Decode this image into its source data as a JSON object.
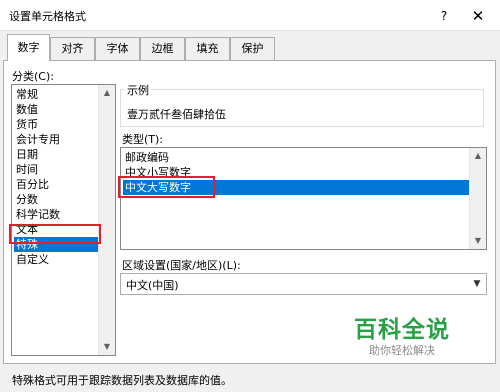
{
  "window": {
    "title": "设置单元格格式",
    "help_label": "?",
    "close_label": "✕"
  },
  "tabs": [
    {
      "label": "数字",
      "active": true
    },
    {
      "label": "对齐",
      "active": false
    },
    {
      "label": "字体",
      "active": false
    },
    {
      "label": "边框",
      "active": false
    },
    {
      "label": "填充",
      "active": false
    },
    {
      "label": "保护",
      "active": false
    }
  ],
  "category": {
    "label": "分类(C):",
    "items": [
      "常规",
      "数值",
      "货币",
      "会计专用",
      "日期",
      "时间",
      "百分比",
      "分数",
      "科学记数",
      "文本",
      "特殊",
      "自定义"
    ],
    "selected": "特殊"
  },
  "sample": {
    "label": "示例",
    "value": "壹万贰仟叁佰肆拾伍"
  },
  "type": {
    "label": "类型(T):",
    "items": [
      "邮政编码",
      "中文小写数字",
      "中文大写数字"
    ],
    "selected": "中文大写数字"
  },
  "locale": {
    "label": "区域设置(国家/地区)(L):",
    "value": "中文(中国)"
  },
  "description": "特殊格式可用于跟踪数据列表及数据库的值。",
  "watermark": {
    "main": "百科全说",
    "sub": "助你轻松解决"
  },
  "colors": {
    "selection": "#0078d7",
    "highlight_box": "#e0202b",
    "watermark": "#2aa046"
  },
  "icons": {
    "scroll_up": "triangle-up-icon",
    "scroll_down": "triangle-down-icon",
    "dropdown": "chevron-down-icon"
  }
}
